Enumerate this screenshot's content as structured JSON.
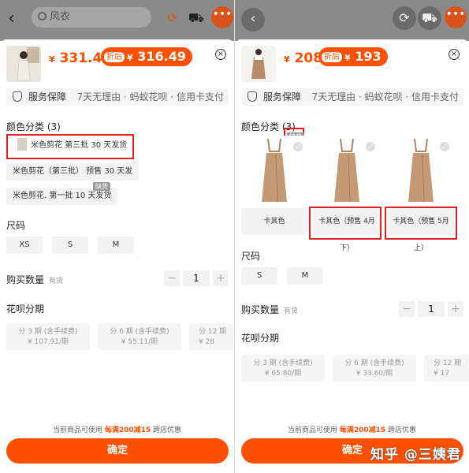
{
  "left": {
    "search_placeholder": "风衣",
    "price": "331.49",
    "sale_tag": "折后",
    "sale_price": "316.49",
    "service_label": "服务保障",
    "service_detail": "7天无理由 · 蚂蚁花呗 · 信用卡支付",
    "color_title": "颜色分类 (3)",
    "colors": [
      {
        "label": "米色剪花 第三批 30 天发货"
      },
      {
        "label": "米色剪花（第三批） 预售 30 天发"
      },
      {
        "label": "米色剪花. 第一批 10 天发货"
      }
    ],
    "badge": "缺货",
    "size_title": "尺码",
    "sizes": [
      "XS",
      "S",
      "M"
    ],
    "qty_title": "购买数量",
    "stock": "有货",
    "qty": "1",
    "installment_title": "花呗分期",
    "installments": [
      {
        "terms": "分 3 期 (含手续费)",
        "amount": "¥ 107.91/期"
      },
      {
        "terms": "分 6 期 (含手续费)",
        "amount": "¥ 55.11/期"
      },
      {
        "terms": "分 12 期",
        "amount": "¥ 28"
      }
    ],
    "notice_prefix": "当前商品可使用",
    "notice_highlight": "每满200减15",
    "notice_suffix": "跨店优惠",
    "confirm": "确定"
  },
  "right": {
    "price": "208",
    "sale_tag": "折后",
    "sale_price": "193",
    "service_label": "服务保障",
    "service_detail": "7天无理由 · 蚂蚁花呗 · 信用卡支付",
    "color_title": "颜色分类 (3)",
    "badge": "缺货",
    "colors": [
      {
        "label": "卡其色"
      },
      {
        "label": "卡其色（预售 4月下）"
      },
      {
        "label": "卡其色（预售 5月上）"
      }
    ],
    "size_title": "尺码",
    "sizes": [
      "S",
      "M"
    ],
    "qty_title": "购买数量",
    "stock": "有货",
    "qty": "1",
    "installment_title": "花呗分期",
    "installments": [
      {
        "terms": "分 3 期 (含手续费)",
        "amount": "¥ 65.80/期"
      },
      {
        "terms": "分 6 期 (含手续费)",
        "amount": "¥ 33.60/期"
      },
      {
        "terms": "分 12 期",
        "amount": "¥ 17"
      }
    ],
    "notice_prefix": "当前商品可使用",
    "notice_highlight": "每满200减15",
    "notice_suffix": "跨店优惠",
    "confirm": "确定"
  },
  "currency": "¥",
  "watermark": "知乎 @三姨君",
  "colors_theme": {
    "accent": "#ff5000",
    "highlight_box": "#e02020"
  }
}
